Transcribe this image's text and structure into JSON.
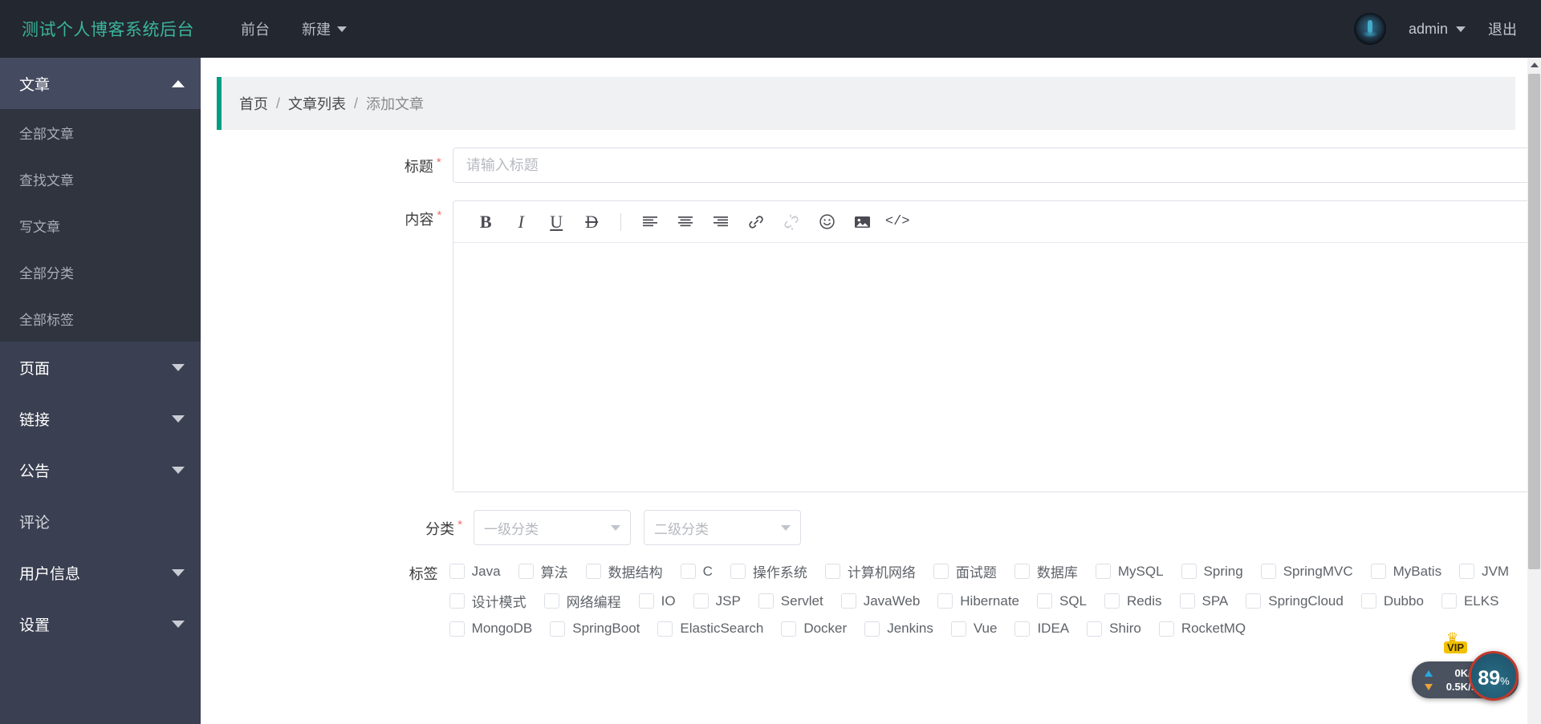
{
  "navbar": {
    "brand": "测试个人博客系统后台",
    "links": [
      {
        "label": "前台",
        "has_caret": false
      },
      {
        "label": "新建",
        "has_caret": true
      }
    ],
    "user": "admin",
    "logout": "退出"
  },
  "sidebar": {
    "groups": [
      {
        "label": "文章",
        "expanded": true,
        "items": [
          "全部文章",
          "查找文章",
          "写文章",
          "全部分类",
          "全部标签"
        ]
      },
      {
        "label": "页面",
        "expanded": false
      },
      {
        "label": "链接",
        "expanded": false
      },
      {
        "label": "公告",
        "expanded": false
      }
    ],
    "plain": [
      "评论"
    ],
    "groups_after": [
      {
        "label": "用户信息",
        "expanded": false
      },
      {
        "label": "设置",
        "expanded": false
      }
    ]
  },
  "breadcrumb": {
    "items": [
      "首页",
      "文章列表",
      "添加文章"
    ],
    "separator": "/"
  },
  "form": {
    "title_label": "标题",
    "title_placeholder": "请输入标题",
    "title_value": "",
    "content_label": "内容",
    "content_value": "",
    "category_label": "分类",
    "category_primary": "一级分类",
    "category_secondary": "二级分类",
    "tags_label": "标签",
    "required_mark": "*"
  },
  "toolbar": {
    "buttons": [
      {
        "name": "bold-icon",
        "glyph": "B",
        "disabled": false
      },
      {
        "name": "italic-icon",
        "glyph": "I",
        "disabled": false
      },
      {
        "name": "underline-icon",
        "glyph": "U",
        "disabled": false
      },
      {
        "name": "strikethrough-icon",
        "glyph": "Ð",
        "disabled": false
      },
      {
        "name": "align-left-icon",
        "glyph": "",
        "disabled": false
      },
      {
        "name": "align-center-icon",
        "glyph": "",
        "disabled": false
      },
      {
        "name": "align-right-icon",
        "glyph": "",
        "disabled": false
      },
      {
        "name": "link-icon",
        "glyph": "",
        "disabled": false
      },
      {
        "name": "unlink-icon",
        "glyph": "",
        "disabled": true
      },
      {
        "name": "emoji-icon",
        "glyph": "",
        "disabled": false
      },
      {
        "name": "image-icon",
        "glyph": "",
        "disabled": false
      },
      {
        "name": "code-icon",
        "glyph": "</>",
        "disabled": false
      }
    ]
  },
  "tags": {
    "rows": [
      [
        "Java",
        "算法",
        "数据结构",
        "C",
        "操作系统",
        "计算机网络",
        "面试题",
        "数据库",
        "MySQL",
        "Spring",
        "SpringMVC",
        "MyBatis",
        "JVM"
      ],
      [
        "设计模式",
        "网络编程",
        "IO",
        "JSP",
        "Servlet",
        "JavaWeb",
        "Hibernate",
        "SQL",
        "Redis",
        "SPA",
        "SpringCloud",
        "Dubbo",
        "ELKS"
      ],
      [
        "MongoDB",
        "SpringBoot",
        "ElasticSearch",
        "Docker",
        "Jenkins",
        "Vue",
        "IDEA",
        "Shiro",
        "RocketMQ"
      ]
    ]
  },
  "net_widget": {
    "upload": "0K/s",
    "download": "0.5K/s",
    "percent": "89",
    "percent_sign": "%",
    "vip": "VIP"
  },
  "colors": {
    "brand_green": "#3bb59a",
    "navbar_bg": "#222730",
    "sidebar_bg": "#3a3f51",
    "submenu_bg": "#2f343f",
    "accent_bar": "#009d82",
    "required": "#f56c6c"
  }
}
